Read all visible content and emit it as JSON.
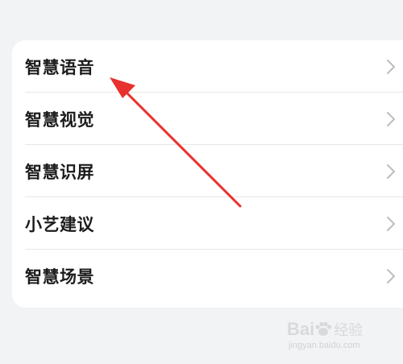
{
  "menu": {
    "items": [
      {
        "label": "智慧语音"
      },
      {
        "label": "智慧视觉"
      },
      {
        "label": "智慧识屏"
      },
      {
        "label": "小艺建议"
      },
      {
        "label": "智慧场景"
      }
    ],
    "chevron_icon": "chevron-right-icon"
  },
  "annotation": {
    "arrow_color": "#e8312f"
  },
  "watermark": {
    "brand_a": "Bai",
    "brand_b": "经验",
    "domain": "jingyan.baidu.com"
  },
  "colors": {
    "background": "#f1f3f5",
    "card": "#ffffff",
    "text": "#1c1c1e",
    "chevron": "#bdbdbd"
  }
}
